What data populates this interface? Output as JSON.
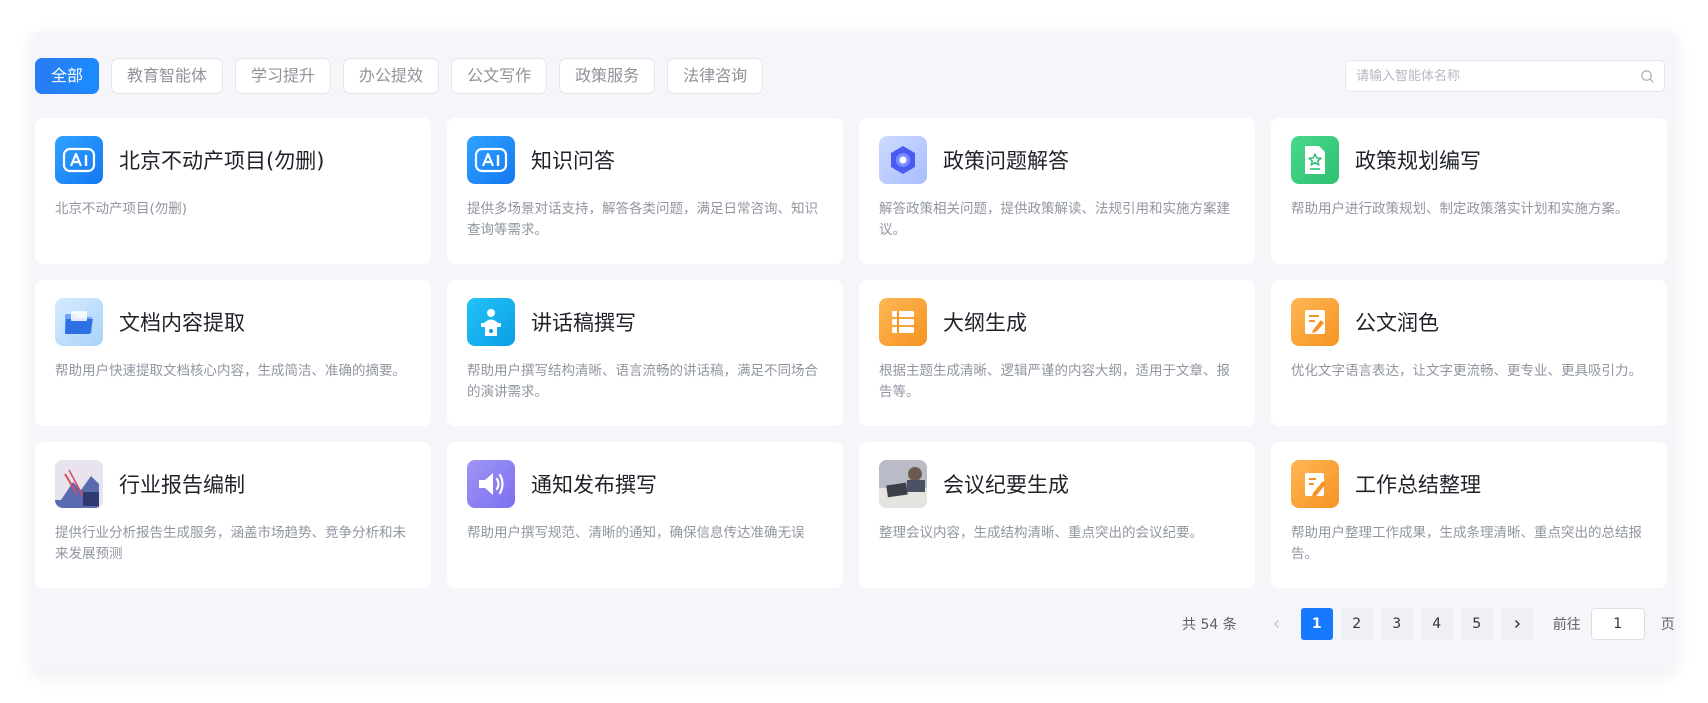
{
  "tabs": [
    {
      "label": "全部",
      "active": true
    },
    {
      "label": "教育智能体",
      "active": false
    },
    {
      "label": "学习提升",
      "active": false
    },
    {
      "label": "办公提效",
      "active": false
    },
    {
      "label": "公文写作",
      "active": false
    },
    {
      "label": "政策服务",
      "active": false
    },
    {
      "label": "法律咨询",
      "active": false
    }
  ],
  "search": {
    "placeholder": "请输入智能体名称",
    "icon": "search-icon"
  },
  "cards": [
    {
      "title": "北京不动产项目(勿删)",
      "desc": "北京不动产项目(勿删)",
      "icon": "ai-icon",
      "color": "#1a8cff"
    },
    {
      "title": "知识问答",
      "desc": "提供多场景对话支持，解答各类问题，满足日常咨询、知识查询等需求。",
      "icon": "ai-icon",
      "color": "#1a8cff"
    },
    {
      "title": "政策问题解答",
      "desc": "解答政策相关问题，提供政策解读、法规引用和实施方案建议。",
      "icon": "policy-badge-icon",
      "color": "#6a7df5"
    },
    {
      "title": "政策规划编写",
      "desc": "帮助用户进行政策规划、制定政策落实计划和实施方案。",
      "icon": "document-star-icon",
      "color": "#3ccb7f"
    },
    {
      "title": "文档内容提取",
      "desc": "帮助用户快速提取文档核心内容，生成简洁、准确的摘要。",
      "icon": "folder-icon",
      "color": "#4a8cf7"
    },
    {
      "title": "讲话稿撰写",
      "desc": "帮助用户撰写结构清晰、语言流畅的讲话稿，满足不同场合的演讲需求。",
      "icon": "podium-speaker-icon",
      "color": "#13aef0"
    },
    {
      "title": "大纲生成",
      "desc": "根据主题生成清晰、逻辑严谨的内容大纲，适用于文章、报告等。",
      "icon": "outline-list-icon",
      "color": "#f7a23b"
    },
    {
      "title": "公文润色",
      "desc": "优化文字语言表达，让文字更流畅、更专业、更具吸引力。",
      "icon": "document-pen-icon",
      "color": "#f7a23b"
    },
    {
      "title": "行业报告编制",
      "desc": "提供行业分析报告生成服务，涵盖市场趋势、竞争分析和未来发展预测",
      "icon": "report-photo-icon",
      "color": "#8a8fb8"
    },
    {
      "title": "通知发布撰写",
      "desc": "帮助用户撰写规范、清晰的通知，确保信息传达准确无误",
      "icon": "speaker-icon",
      "color": "#8b7ff0"
    },
    {
      "title": "会议纪要生成",
      "desc": "整理会议内容，生成结构清晰、重点突出的会议纪要。",
      "icon": "meeting-photo-icon",
      "color": "#7b7f8e"
    },
    {
      "title": "工作总结整理",
      "desc": "帮助用户整理工作成果，生成条理清晰、重点突出的总结报告。",
      "icon": "edit-note-icon",
      "color": "#f7a23b"
    }
  ],
  "pagination": {
    "total_text": "共 54 条",
    "pages": [
      "1",
      "2",
      "3",
      "4",
      "5"
    ],
    "current": "1",
    "goto_label": "前往",
    "goto_value": "1",
    "page_suffix": "页"
  }
}
